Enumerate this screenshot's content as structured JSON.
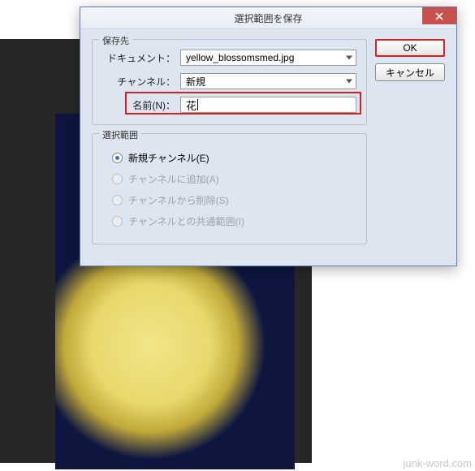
{
  "canvas": {
    "image_alt": "yellow blossoms photo"
  },
  "dialog": {
    "title": "選択範囲を保存",
    "close_label": "close",
    "buttons": {
      "ok": "OK",
      "cancel": "キャンセル"
    },
    "groups": {
      "destination_legend": "保存先",
      "operation_legend": "選択範囲"
    },
    "fields": {
      "document_label": "ドキュメント：",
      "document_value": "yellow_blossomsmed.jpg",
      "channel_label": "チャンネル：",
      "channel_value": "新規",
      "name_label": "名前(N)：",
      "name_value": "花"
    },
    "radios": {
      "new_channel": "新規チャンネル(E)",
      "add_to_channel": "チャンネルに追加(A)",
      "subtract_from_channel": "チャンネルから削除(S)",
      "intersect_channel": "チャンネルとの共通範囲(I)"
    }
  },
  "watermark": "junk-word.com"
}
